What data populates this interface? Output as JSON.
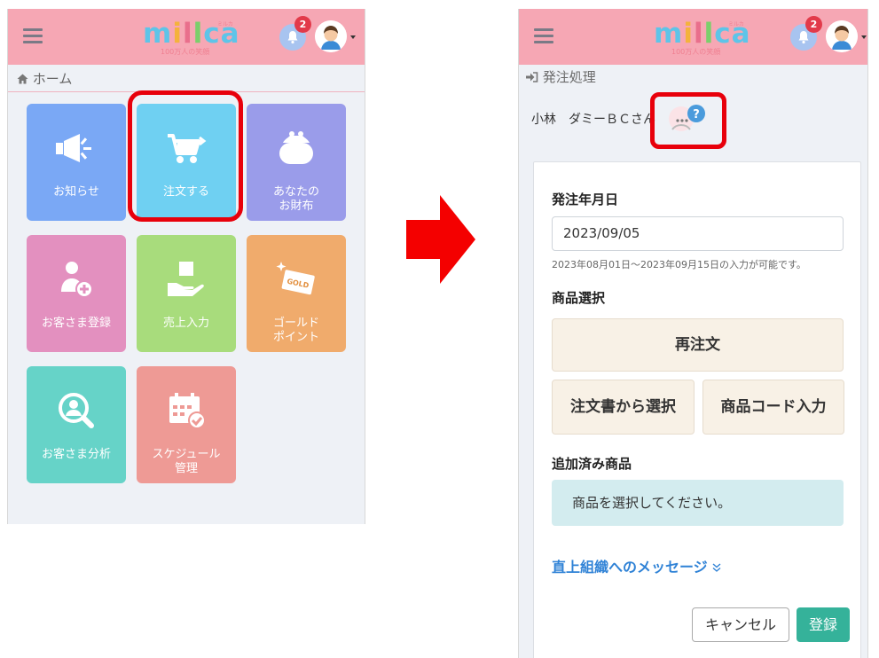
{
  "left_screen": {
    "header": {
      "badge_count": "2"
    },
    "logo": {
      "text": [
        "m",
        "i",
        "l",
        "l",
        "c",
        "a"
      ],
      "subtitle": "100万人の笑顔",
      "ruby": "ミルカ"
    },
    "breadcrumb": {
      "icon": "home-icon",
      "label": "ホーム"
    },
    "tiles": [
      {
        "label": "お知らせ",
        "color": "#7aa8f5",
        "icon": "megaphone-icon"
      },
      {
        "label": "注文する",
        "color": "#6fd0f2",
        "icon": "cart-icon"
      },
      {
        "label": "あなたの\nお財布",
        "color": "#9a9cea",
        "icon": "purse-icon"
      },
      {
        "label": "お客さま登録",
        "color": "#e390bf",
        "icon": "add-person-icon"
      },
      {
        "label": "売上入力",
        "color": "#a8dc7c",
        "icon": "hand-box-icon"
      },
      {
        "label": "ゴールド\nポイント",
        "color": "#f0ab6c",
        "icon": "gold-card-icon"
      },
      {
        "label": "お客さま分析",
        "color": "#66d3c8",
        "icon": "search-person-icon"
      },
      {
        "label": "スケジュール\n管理",
        "color": "#ee9a95",
        "icon": "calendar-check-icon"
      }
    ]
  },
  "right_screen": {
    "header": {
      "badge_count": "2"
    },
    "page_title": {
      "icon": "sign-in-icon",
      "label": "発注処理"
    },
    "user_name": "小林　ダミーＢＣさん",
    "form": {
      "order_date_label": "発注年月日",
      "order_date_value": "2023/09/05",
      "date_hint": "2023年08月01日～2023年09月15日の入力が可能です。",
      "product_select_label": "商品選択",
      "reorder_button": "再注文",
      "select_from_order_button": "注文書から選択",
      "product_code_button": "商品コード入力",
      "added_products_label": "追加済み商品",
      "empty_message": "商品を選択してください。",
      "message_link": "直上組織へのメッセージ",
      "cancel_button": "キャンセル",
      "submit_button": "登録"
    }
  },
  "colors": {
    "header_pink": "#f6a7b4",
    "highlight_red": "#e8000b",
    "submit_green": "#35b29a",
    "link_blue": "#2f82d6"
  }
}
